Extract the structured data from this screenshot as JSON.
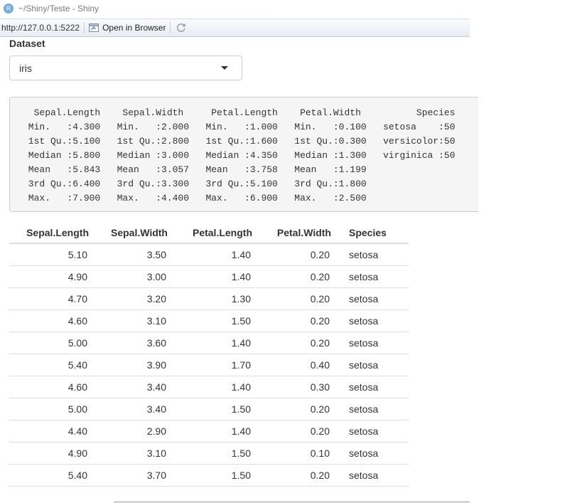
{
  "window": {
    "icon_letter": "R",
    "title": "~/Shiny/Teste - Shiny"
  },
  "toolbar": {
    "url": "http://127.0.0.1:5222",
    "open_in_browser": "Open in Browser"
  },
  "input": {
    "label": "Dataset",
    "selected": "iris"
  },
  "summary_text": "  Sepal.Length    Sepal.Width     Petal.Length    Petal.Width          Species  \n Min.   :4.300   Min.   :2.000   Min.   :1.000   Min.   :0.100   setosa    :50  \n 1st Qu.:5.100   1st Qu.:2.800   1st Qu.:1.600   1st Qu.:0.300   versicolor:50  \n Median :5.800   Median :3.000   Median :4.350   Median :1.300   virginica :50  \n Mean   :5.843   Mean   :3.057   Mean   :3.758   Mean   :1.199                  \n 3rd Qu.:6.400   3rd Qu.:3.300   3rd Qu.:5.100   3rd Qu.:1.800                  \n Max.   :7.900   Max.   :4.400   Max.   :6.900   Max.   :2.500                  ",
  "table": {
    "columns": [
      "Sepal.Length",
      "Sepal.Width",
      "Petal.Length",
      "Petal.Width",
      "Species"
    ],
    "rows": [
      [
        "5.10",
        "3.50",
        "1.40",
        "0.20",
        "setosa"
      ],
      [
        "4.90",
        "3.00",
        "1.40",
        "0.20",
        "setosa"
      ],
      [
        "4.70",
        "3.20",
        "1.30",
        "0.20",
        "setosa"
      ],
      [
        "4.60",
        "3.10",
        "1.50",
        "0.20",
        "setosa"
      ],
      [
        "5.00",
        "3.60",
        "1.40",
        "0.20",
        "setosa"
      ],
      [
        "5.40",
        "3.90",
        "1.70",
        "0.40",
        "setosa"
      ],
      [
        "4.60",
        "3.40",
        "1.40",
        "0.30",
        "setosa"
      ],
      [
        "5.00",
        "3.40",
        "1.50",
        "0.20",
        "setosa"
      ],
      [
        "4.40",
        "2.90",
        "1.40",
        "0.20",
        "setosa"
      ],
      [
        "4.90",
        "3.10",
        "1.50",
        "0.10",
        "setosa"
      ],
      [
        "5.40",
        "3.70",
        "1.50",
        "0.20",
        "setosa"
      ]
    ]
  },
  "icons": {
    "app": "r-logo-icon",
    "open_browser": "browser-window-icon",
    "refresh": "refresh-icon",
    "dropdown": "caret-down-icon"
  },
  "colors": {
    "app_icon": "#75aadb",
    "summary_background": "#f5f5f5"
  }
}
